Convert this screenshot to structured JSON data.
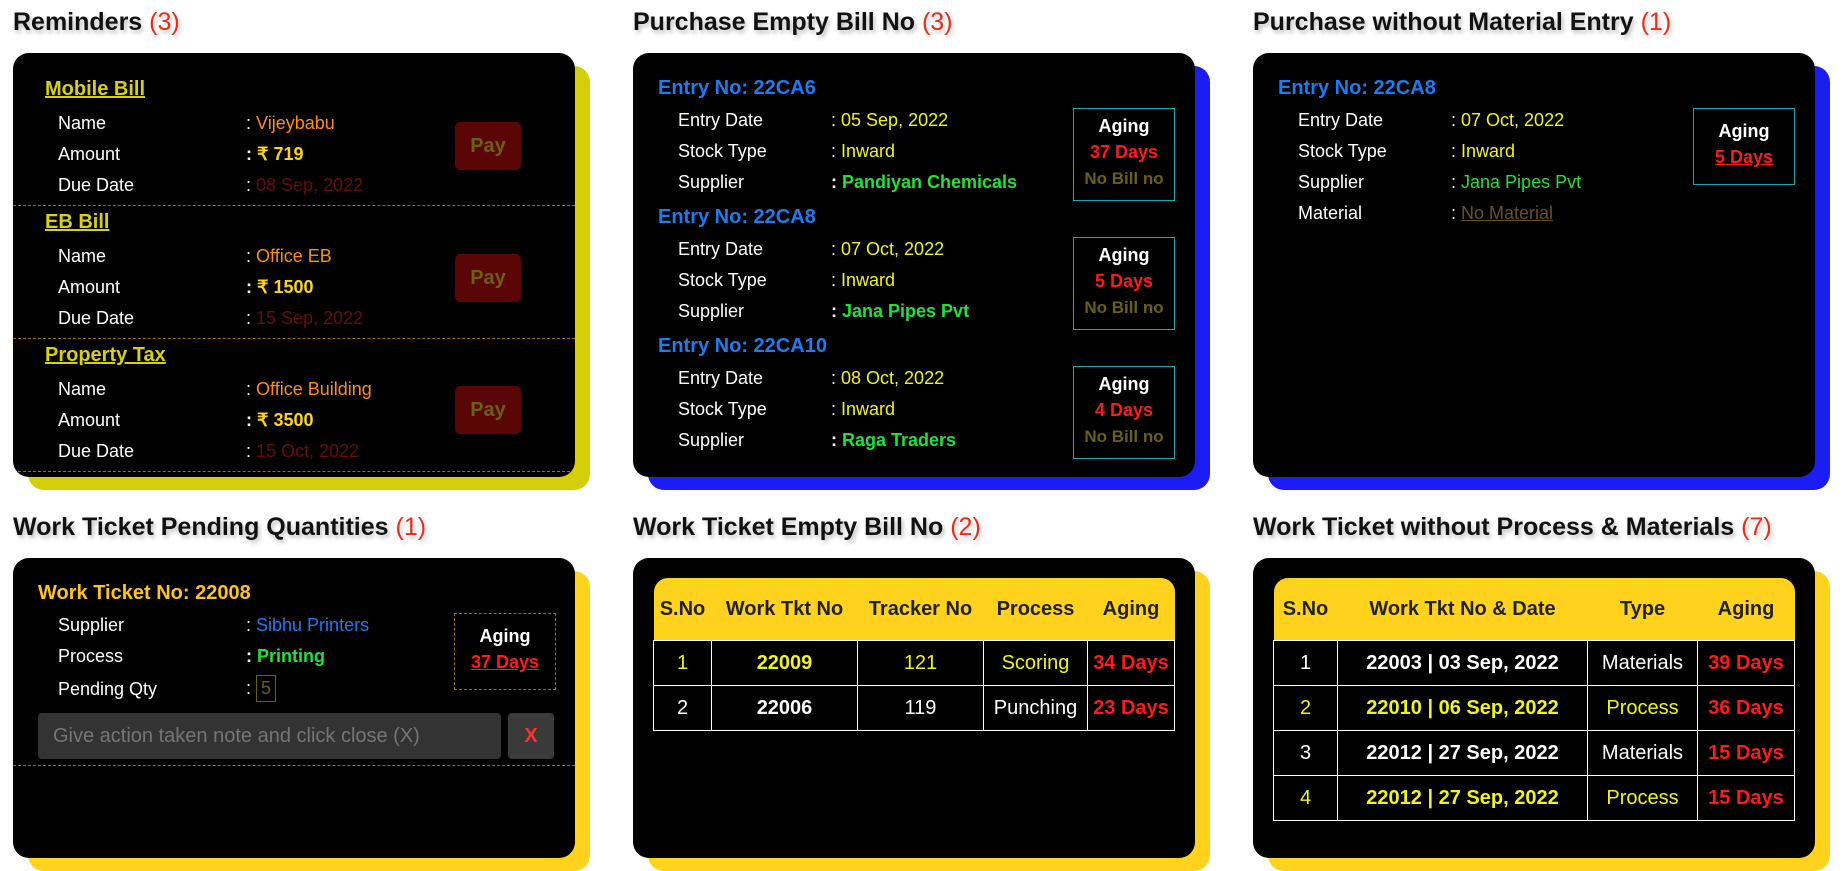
{
  "reminders": {
    "title": "Reminders",
    "count": "(3)",
    "items": [
      {
        "header": "Mobile Bill",
        "name": "Vijeybabu",
        "amount": "₹ 719",
        "due": "08 Sep, 2022",
        "pay": "Pay"
      },
      {
        "header": "EB Bill",
        "name": "Office EB",
        "amount": "₹ 1500",
        "due": "15 Sep, 2022",
        "pay": "Pay"
      },
      {
        "header": "Property Tax",
        "name": "Office Building",
        "amount": "₹ 3500",
        "due": "15 Oct, 2022",
        "pay": "Pay"
      }
    ],
    "labels": {
      "name": "Name",
      "amount": "Amount",
      "due": "Due Date"
    }
  },
  "purchase_empty": {
    "title": "Purchase Empty Bill No",
    "count": "(3)",
    "labels": {
      "entry_date": "Entry Date",
      "stock_type": "Stock Type",
      "supplier": "Supplier",
      "aging": "Aging"
    },
    "items": [
      {
        "entry": "Entry No: 22CA6",
        "date": "05 Sep, 2022",
        "stock": "Inward",
        "supplier": "Pandiyan Chemicals",
        "days": "37 Days",
        "bill": "No Bill no"
      },
      {
        "entry": "Entry No: 22CA8",
        "date": "07 Oct, 2022",
        "stock": "Inward",
        "supplier": "Jana Pipes Pvt",
        "days": "5 Days",
        "bill": "No Bill no"
      },
      {
        "entry": "Entry No: 22CA10",
        "date": "08 Oct, 2022",
        "stock": "Inward",
        "supplier": "Raga Traders",
        "days": "4 Days",
        "bill": "No Bill no"
      }
    ]
  },
  "purchase_nomat": {
    "title": "Purchase without Material Entry",
    "count": "(1)",
    "labels": {
      "entry_date": "Entry Date",
      "stock_type": "Stock Type",
      "supplier": "Supplier",
      "material": "Material",
      "aging": "Aging"
    },
    "item": {
      "entry": "Entry No: 22CA8",
      "date": "07 Oct, 2022",
      "stock": "Inward",
      "supplier": "Jana Pipes Pvt",
      "material": "No Material",
      "days": "5 Days"
    }
  },
  "wt_pending": {
    "title": "Work Ticket Pending Quantities",
    "count": "(1)",
    "ticket": "Work Ticket No: 22008",
    "labels": {
      "supplier": "Supplier",
      "process": "Process",
      "pending": "Pending Qty",
      "aging": "Aging"
    },
    "supplier": "Sibhu Printers",
    "process": "Printing",
    "pending": "5",
    "days": "37 Days",
    "note_placeholder": "Give action taken note and click close (X)",
    "close": "X"
  },
  "wt_empty": {
    "title": "Work Ticket Empty Bill No",
    "count": "(2)",
    "headers": [
      "S.No",
      "Work Tkt No",
      "Tracker No",
      "Process",
      "Aging"
    ],
    "rows": [
      [
        "1",
        "22009",
        "121",
        "Scoring",
        "34 Days"
      ],
      [
        "2",
        "22006",
        "119",
        "Punching",
        "23 Days"
      ]
    ]
  },
  "wt_noproc": {
    "title": "Work Ticket without Process & Materials",
    "count": "(7)",
    "headers": [
      "S.No",
      "Work Tkt No & Date",
      "Type",
      "Aging"
    ],
    "rows": [
      [
        "1",
        "22003 | 03 Sep, 2022",
        "Materials",
        "39 Days"
      ],
      [
        "2",
        "22010 | 06 Sep, 2022",
        "Process",
        "36 Days"
      ],
      [
        "3",
        "22012 | 27 Sep, 2022",
        "Materials",
        "15 Days"
      ],
      [
        "4",
        "22012 | 27 Sep, 2022",
        "Process",
        "15 Days"
      ]
    ]
  },
  "colors": {
    "yellow_shadow": "#d4cf0a",
    "blue_shadow": "#1c1cf5",
    "gold_shadow": "#ffd21e"
  }
}
